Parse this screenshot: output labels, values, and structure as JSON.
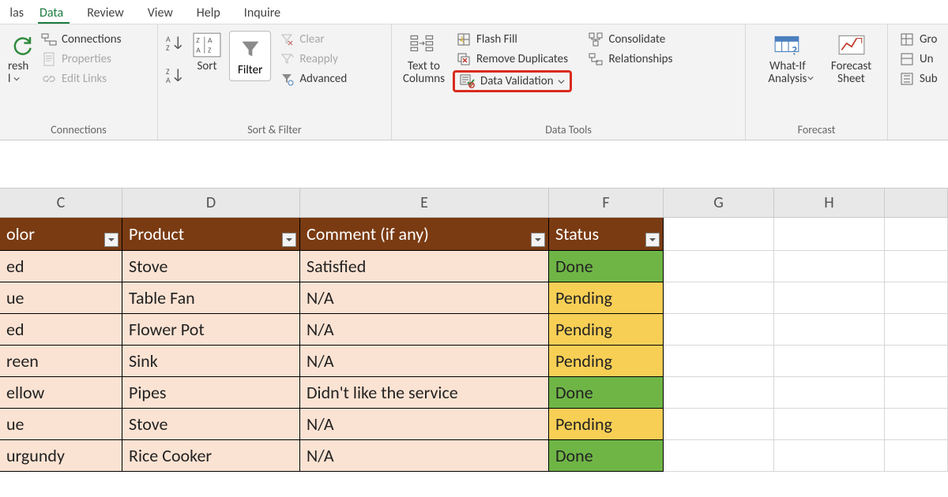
{
  "tabs": {
    "first_partial": "las",
    "active": "Data",
    "items": [
      "Review",
      "View",
      "Help",
      "Inquire"
    ]
  },
  "ribbon": {
    "connections": {
      "refresh_partial": "resh",
      "refresh_partial2": "l",
      "connections": "Connections",
      "properties": "Properties",
      "edit_links": "Edit Links",
      "label": "Connections"
    },
    "sortfilter": {
      "sort": "Sort",
      "filter": "Filter",
      "clear": "Clear",
      "reapply": "Reapply",
      "advanced": "Advanced",
      "label": "Sort & Filter"
    },
    "datatools": {
      "text_to_columns": "Text to\nColumns",
      "flash_fill": "Flash Fill",
      "remove_duplicates": "Remove Duplicates",
      "data_validation": "Data Validation",
      "consolidate": "Consolidate",
      "relationships": "Relationships",
      "label": "Data Tools"
    },
    "forecast": {
      "whatif": "What-If\nAnalysis",
      "forecast_sheet": "Forecast\nSheet",
      "label": "Forecast"
    },
    "outline": {
      "group": "Gro",
      "ungroup": "Un",
      "subtotal": "Sub"
    }
  },
  "columns": {
    "C": "C",
    "D": "D",
    "E": "E",
    "F": "F",
    "G": "G",
    "H": "H"
  },
  "headers": {
    "color": "olor",
    "product": "Product",
    "comment": "Comment (if any)",
    "status": "Status"
  },
  "rows": [
    {
      "color": "ed",
      "product": "Stove",
      "comment": "Satisfied",
      "status": "Done",
      "status_class": "status-done"
    },
    {
      "color": "ue",
      "product": "Table Fan",
      "comment": "N/A",
      "status": "Pending",
      "status_class": "status-pending"
    },
    {
      "color": "ed",
      "product": "Flower Pot",
      "comment": "N/A",
      "status": "Pending",
      "status_class": "status-pending"
    },
    {
      "color": "reen",
      "product": "Sink",
      "comment": "N/A",
      "status": "Pending",
      "status_class": "status-pending"
    },
    {
      "color": "ellow",
      "product": "Pipes",
      "comment": "Didn't like the service",
      "status": "Done",
      "status_class": "status-done"
    },
    {
      "color": "ue",
      "product": "Stove",
      "comment": "N/A",
      "status": "Pending",
      "status_class": "status-pending"
    },
    {
      "color": "urgundy",
      "product": "Rice Cooker",
      "comment": "N/A",
      "status": "Done",
      "status_class": "status-done"
    }
  ]
}
